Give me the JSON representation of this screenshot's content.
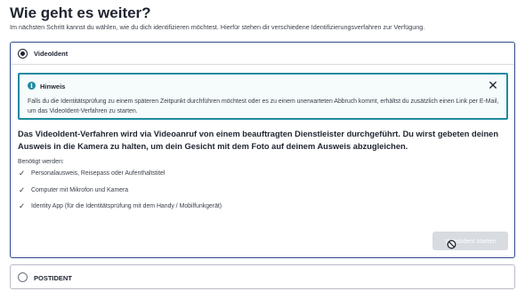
{
  "header": {
    "title": "Wie geht es weiter?",
    "subtitle": "Im nächsten Schritt kannst du wählen, wie du dich identifizieren möchtest. Hierfür stehen dir verschiedene Identifizierungsverfahren zur Verfügung."
  },
  "options": [
    {
      "label": "VideoIdent",
      "selected": true,
      "hint": {
        "icon": "info-icon",
        "title": "Hinweis",
        "text": "Falls du die Identitätsprüfung zu einem späteren Zeitpunkt durchführen möchtest oder es zu einem unerwarteten Abbruch kommt, erhältst du zusätzlich einen Link per E-Mail, um das VideoIdent-Verfahren zu starten.",
        "close_symbol": "✕"
      },
      "description": "Das VideoIdent-Verfahren wird via Videoanruf von einem beauftragten Dienstleister durchgeführt. Du wirst gebeten deinen Ausweis in die Kamera zu halten, um dein Gesicht mit dem Foto auf deinem Ausweis abzugleichen.",
      "requirements_label": "Benötigt werden:",
      "requirements": [
        "Personalausweis, Reisepass oder Aufenthaltstitel",
        "Computer mit Mikrofon und Kamera",
        "Identity App (für die Identitätsprüfung mit dem Handy / Mobilfunkgerät)"
      ],
      "check_symbol": "✓",
      "start_button_label": "VideoIdent starten",
      "start_button_enabled": false
    },
    {
      "label": "POSTIDENT",
      "selected": false
    }
  ],
  "colors": {
    "selected_border": "#2f4a8a",
    "hint_accent": "#1e8a9e",
    "disabled_button": "#d8dbe0"
  }
}
